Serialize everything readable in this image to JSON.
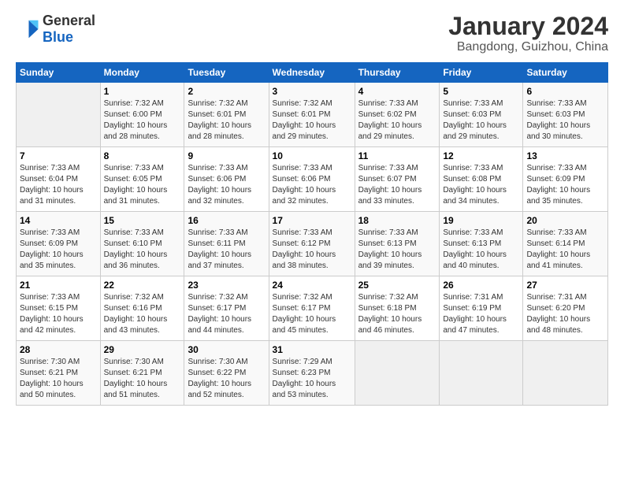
{
  "logo": {
    "line1": "General",
    "line2": "Blue"
  },
  "header": {
    "month": "January 2024",
    "location": "Bangdong, Guizhou, China"
  },
  "weekdays": [
    "Sunday",
    "Monday",
    "Tuesday",
    "Wednesday",
    "Thursday",
    "Friday",
    "Saturday"
  ],
  "weeks": [
    [
      {
        "day": "",
        "info": ""
      },
      {
        "day": "1",
        "info": "Sunrise: 7:32 AM\nSunset: 6:00 PM\nDaylight: 10 hours\nand 28 minutes."
      },
      {
        "day": "2",
        "info": "Sunrise: 7:32 AM\nSunset: 6:01 PM\nDaylight: 10 hours\nand 28 minutes."
      },
      {
        "day": "3",
        "info": "Sunrise: 7:32 AM\nSunset: 6:01 PM\nDaylight: 10 hours\nand 29 minutes."
      },
      {
        "day": "4",
        "info": "Sunrise: 7:33 AM\nSunset: 6:02 PM\nDaylight: 10 hours\nand 29 minutes."
      },
      {
        "day": "5",
        "info": "Sunrise: 7:33 AM\nSunset: 6:03 PM\nDaylight: 10 hours\nand 29 minutes."
      },
      {
        "day": "6",
        "info": "Sunrise: 7:33 AM\nSunset: 6:03 PM\nDaylight: 10 hours\nand 30 minutes."
      }
    ],
    [
      {
        "day": "7",
        "info": "Sunrise: 7:33 AM\nSunset: 6:04 PM\nDaylight: 10 hours\nand 31 minutes."
      },
      {
        "day": "8",
        "info": "Sunrise: 7:33 AM\nSunset: 6:05 PM\nDaylight: 10 hours\nand 31 minutes."
      },
      {
        "day": "9",
        "info": "Sunrise: 7:33 AM\nSunset: 6:06 PM\nDaylight: 10 hours\nand 32 minutes."
      },
      {
        "day": "10",
        "info": "Sunrise: 7:33 AM\nSunset: 6:06 PM\nDaylight: 10 hours\nand 32 minutes."
      },
      {
        "day": "11",
        "info": "Sunrise: 7:33 AM\nSunset: 6:07 PM\nDaylight: 10 hours\nand 33 minutes."
      },
      {
        "day": "12",
        "info": "Sunrise: 7:33 AM\nSunset: 6:08 PM\nDaylight: 10 hours\nand 34 minutes."
      },
      {
        "day": "13",
        "info": "Sunrise: 7:33 AM\nSunset: 6:09 PM\nDaylight: 10 hours\nand 35 minutes."
      }
    ],
    [
      {
        "day": "14",
        "info": "Sunrise: 7:33 AM\nSunset: 6:09 PM\nDaylight: 10 hours\nand 35 minutes."
      },
      {
        "day": "15",
        "info": "Sunrise: 7:33 AM\nSunset: 6:10 PM\nDaylight: 10 hours\nand 36 minutes."
      },
      {
        "day": "16",
        "info": "Sunrise: 7:33 AM\nSunset: 6:11 PM\nDaylight: 10 hours\nand 37 minutes."
      },
      {
        "day": "17",
        "info": "Sunrise: 7:33 AM\nSunset: 6:12 PM\nDaylight: 10 hours\nand 38 minutes."
      },
      {
        "day": "18",
        "info": "Sunrise: 7:33 AM\nSunset: 6:13 PM\nDaylight: 10 hours\nand 39 minutes."
      },
      {
        "day": "19",
        "info": "Sunrise: 7:33 AM\nSunset: 6:13 PM\nDaylight: 10 hours\nand 40 minutes."
      },
      {
        "day": "20",
        "info": "Sunrise: 7:33 AM\nSunset: 6:14 PM\nDaylight: 10 hours\nand 41 minutes."
      }
    ],
    [
      {
        "day": "21",
        "info": "Sunrise: 7:33 AM\nSunset: 6:15 PM\nDaylight: 10 hours\nand 42 minutes."
      },
      {
        "day": "22",
        "info": "Sunrise: 7:32 AM\nSunset: 6:16 PM\nDaylight: 10 hours\nand 43 minutes."
      },
      {
        "day": "23",
        "info": "Sunrise: 7:32 AM\nSunset: 6:17 PM\nDaylight: 10 hours\nand 44 minutes."
      },
      {
        "day": "24",
        "info": "Sunrise: 7:32 AM\nSunset: 6:17 PM\nDaylight: 10 hours\nand 45 minutes."
      },
      {
        "day": "25",
        "info": "Sunrise: 7:32 AM\nSunset: 6:18 PM\nDaylight: 10 hours\nand 46 minutes."
      },
      {
        "day": "26",
        "info": "Sunrise: 7:31 AM\nSunset: 6:19 PM\nDaylight: 10 hours\nand 47 minutes."
      },
      {
        "day": "27",
        "info": "Sunrise: 7:31 AM\nSunset: 6:20 PM\nDaylight: 10 hours\nand 48 minutes."
      }
    ],
    [
      {
        "day": "28",
        "info": "Sunrise: 7:30 AM\nSunset: 6:21 PM\nDaylight: 10 hours\nand 50 minutes."
      },
      {
        "day": "29",
        "info": "Sunrise: 7:30 AM\nSunset: 6:21 PM\nDaylight: 10 hours\nand 51 minutes."
      },
      {
        "day": "30",
        "info": "Sunrise: 7:30 AM\nSunset: 6:22 PM\nDaylight: 10 hours\nand 52 minutes."
      },
      {
        "day": "31",
        "info": "Sunrise: 7:29 AM\nSunset: 6:23 PM\nDaylight: 10 hours\nand 53 minutes."
      },
      {
        "day": "",
        "info": ""
      },
      {
        "day": "",
        "info": ""
      },
      {
        "day": "",
        "info": ""
      }
    ]
  ]
}
